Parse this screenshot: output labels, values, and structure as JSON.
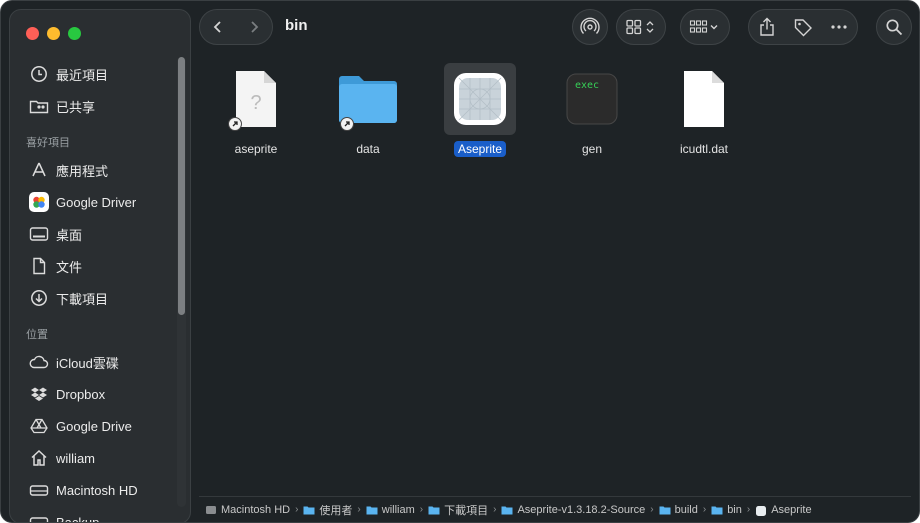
{
  "window": {
    "title": "bin"
  },
  "sidebar": {
    "items_top": [
      {
        "label": "最近項目",
        "icon": "clock-icon"
      },
      {
        "label": "已共享",
        "icon": "shared-folder-icon"
      }
    ],
    "favorites_header": "喜好項目",
    "favorites": [
      {
        "label": "應用程式",
        "icon": "applications-icon"
      },
      {
        "label": "Google Driver",
        "icon": "google-drive-icon"
      },
      {
        "label": "桌面",
        "icon": "desktop-icon"
      },
      {
        "label": "文件",
        "icon": "document-icon"
      },
      {
        "label": "下載項目",
        "icon": "download-icon"
      }
    ],
    "locations_header": "位置",
    "locations": [
      {
        "label": "iCloud雲碟",
        "icon": "cloud-icon"
      },
      {
        "label": "Dropbox",
        "icon": "dropbox-icon"
      },
      {
        "label": "Google Drive",
        "icon": "drive-icon"
      },
      {
        "label": "william",
        "icon": "home-icon"
      },
      {
        "label": "Macintosh HD",
        "icon": "disk-icon"
      },
      {
        "label": "Backup",
        "icon": "disk-icon"
      }
    ]
  },
  "files": [
    {
      "name": "aseprite",
      "kind": "alias-unknown"
    },
    {
      "name": "data",
      "kind": "alias-folder"
    },
    {
      "name": "Aseprite",
      "kind": "app",
      "selected": true
    },
    {
      "name": "gen",
      "kind": "exec",
      "badge": "exec"
    },
    {
      "name": "icudtl.dat",
      "kind": "document"
    }
  ],
  "pathbar": [
    {
      "label": "Macintosh HD",
      "icon": "disk-icon"
    },
    {
      "label": "使用者",
      "icon": "folder-icon"
    },
    {
      "label": "william",
      "icon": "folder-icon"
    },
    {
      "label": "下載項目",
      "icon": "folder-icon"
    },
    {
      "label": "Aseprite-v1.3.18.2-Source",
      "icon": "folder-icon"
    },
    {
      "label": "build",
      "icon": "folder-icon"
    },
    {
      "label": "bin",
      "icon": "folder-icon"
    },
    {
      "label": "Aseprite",
      "icon": "app-icon"
    }
  ],
  "colors": {
    "selection": "#1a5ec9",
    "folder": "#5ab4f0"
  }
}
